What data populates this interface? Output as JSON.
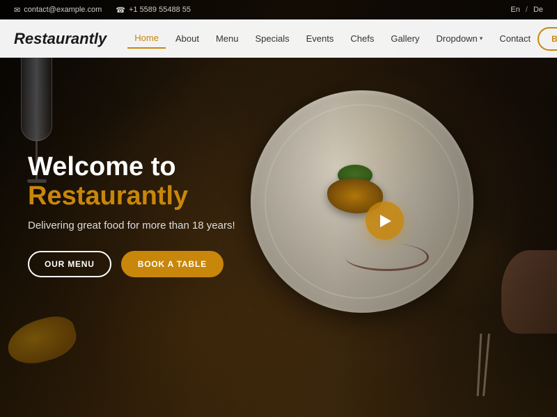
{
  "topbar": {
    "email": "contact@example.com",
    "phone": "+1 5589 55488 55",
    "lang_en": "En",
    "lang_de": "De",
    "lang_separator": "/"
  },
  "navbar": {
    "logo": "Restaurantly",
    "links": [
      {
        "label": "Home",
        "active": true
      },
      {
        "label": "About",
        "active": false
      },
      {
        "label": "Menu",
        "active": false
      },
      {
        "label": "Specials",
        "active": false
      },
      {
        "label": "Events",
        "active": false
      },
      {
        "label": "Chefs",
        "active": false
      },
      {
        "label": "Gallery",
        "active": false
      },
      {
        "label": "Dropdown",
        "active": false,
        "hasDropdown": true
      },
      {
        "label": "Contact",
        "active": false
      }
    ],
    "book_btn": "BOOK A TABLE"
  },
  "hero": {
    "title_prefix": "Welcome to ",
    "title_brand": "Restaurantly",
    "subtitle": "Delivering great food for more than 18 years!",
    "btn_menu": "OUR MENU",
    "btn_book": "BOOK A TABLE"
  },
  "colors": {
    "gold": "#c8860a",
    "white": "#ffffff",
    "dark": "#1a1008"
  }
}
